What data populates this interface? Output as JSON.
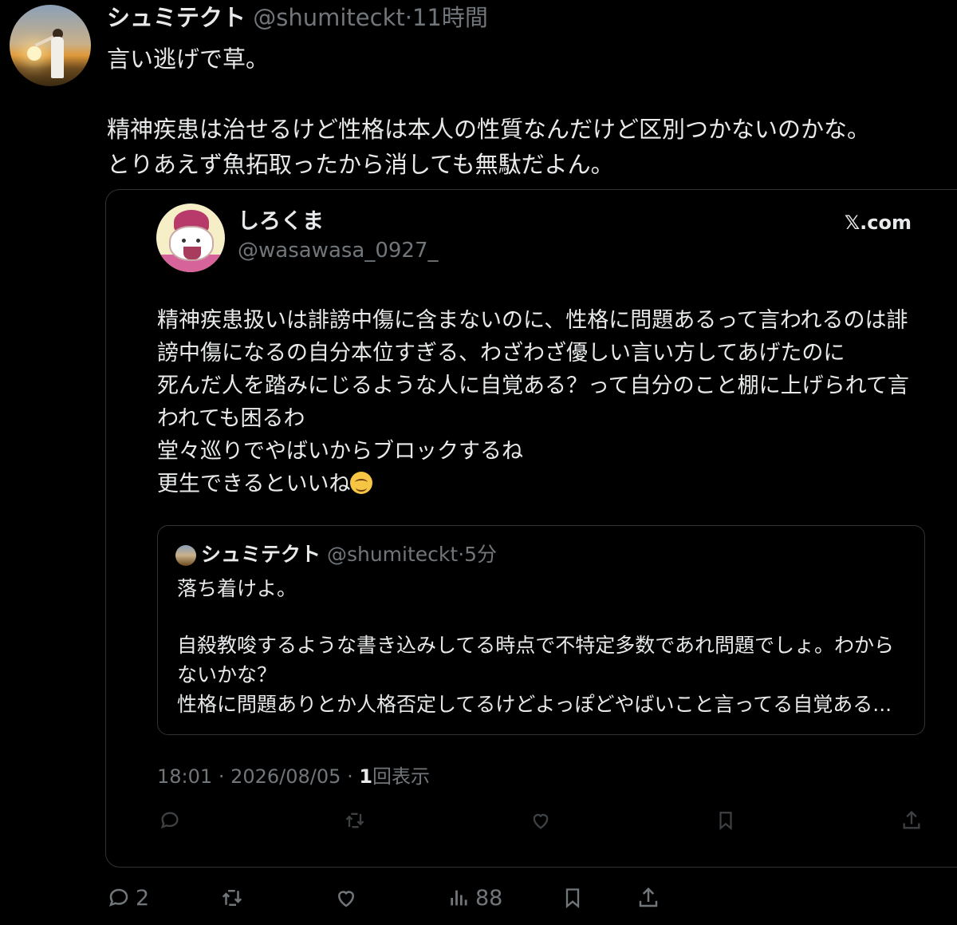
{
  "tweet": {
    "author_name": "シュミテクト",
    "handle": "@shumiteckt",
    "separator": "·",
    "time": "11時間",
    "lines": [
      "言い逃げで草。",
      "",
      "精神疾患は治せるけど性格は本人の性質なんだけど区別つかないのかな。",
      "とりあえず魚拓取ったから消しても無駄だよん。"
    ]
  },
  "quote_card": {
    "author_name": "しろくま",
    "handle": "@wasawasa_0927_",
    "site": "𝕏.com",
    "lines": [
      "精神疾患扱いは誹謗中傷に含まないのに、性格に問題あるって言われるのは誹",
      "謗中傷になるの自分本位すぎる、わざわざ優しい言い方してあげたのに",
      "死んだ人を踏みにじるような人に自覚ある？って自分のこと棚に上げられて言",
      "われても困るわ",
      "堂々巡りでやばいからブロックするね",
      "更生できるといいね"
    ],
    "emoji_name": "smiling-face-emoji",
    "nested_quote": {
      "author_name": "シュミテクト",
      "handle": "@shumiteckt",
      "separator": "·",
      "time": "5分",
      "lines": [
        "落ち着けよ。",
        "",
        "自殺教唆するような書き込みしてる時点で不特定多数であれ問題でしょ。わから",
        "ないかな？",
        "性格に問題ありとか人格否定してるけどよっぽどやばいこと言ってる自覚ある..."
      ]
    },
    "meta": {
      "time": "18:01",
      "separator": "·",
      "date": "2026/08/05",
      "views_count": "1",
      "views_label": "回表示"
    },
    "action_icons": [
      "reply-icon",
      "retweet-icon",
      "like-icon",
      "bookmark-icon",
      "share-icon"
    ]
  },
  "actions": {
    "reply_count": "2",
    "views_count": "88"
  },
  "colors": {
    "background": "#000000",
    "text": "#e7e9ea",
    "secondary": "#71767b",
    "border": "#2f3336"
  }
}
